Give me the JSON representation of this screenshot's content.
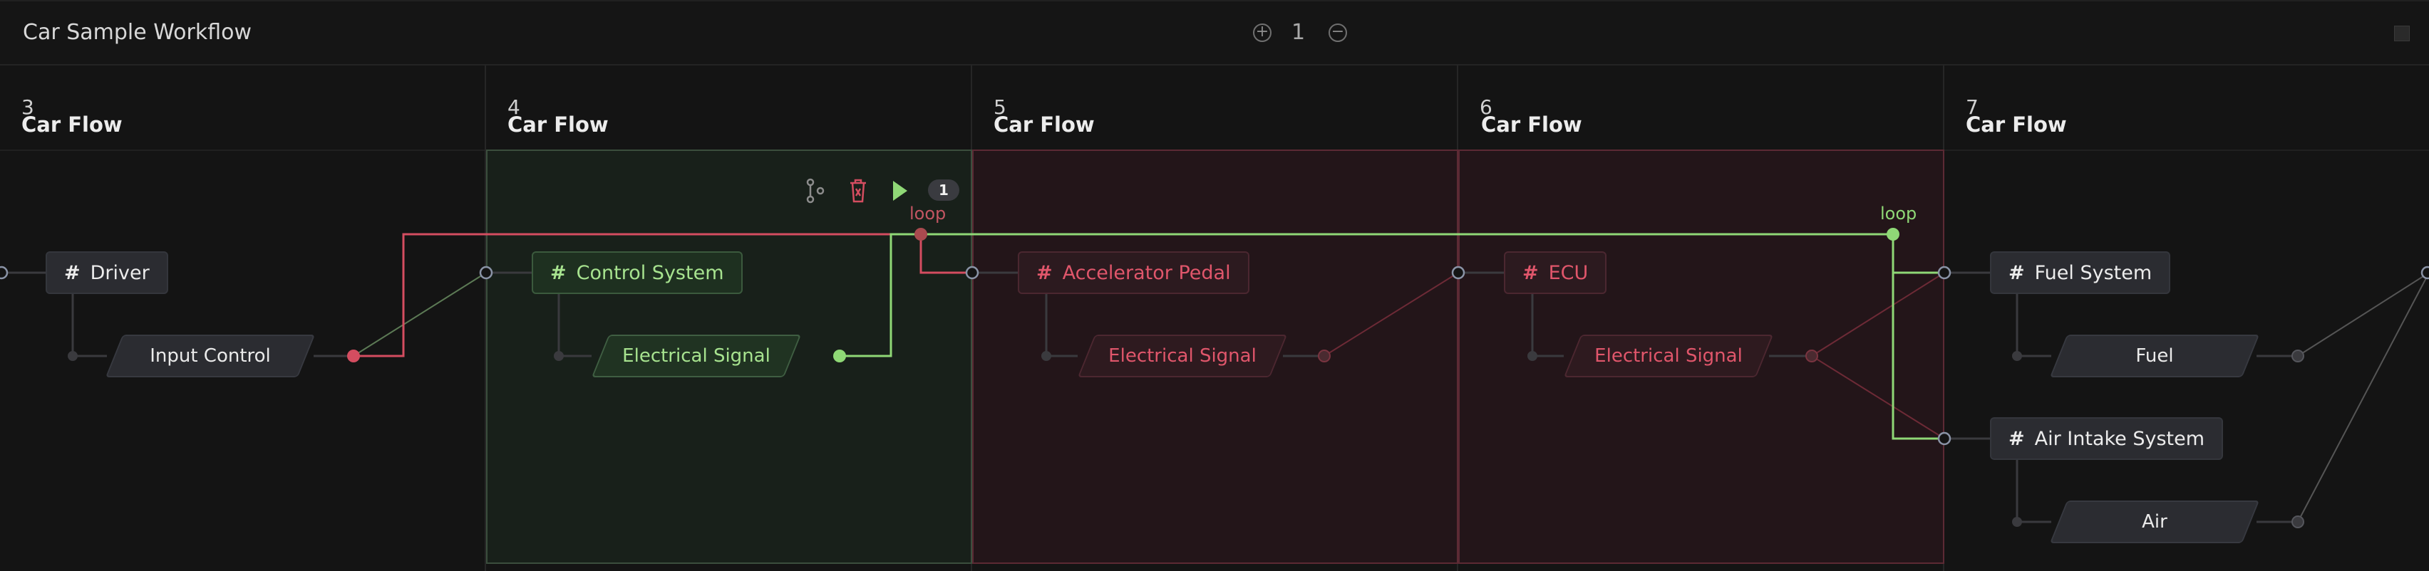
{
  "header": {
    "title": "Car Sample Workflow",
    "zoom_level": "1",
    "zoom_in_icon": "plus-circle-icon",
    "zoom_out_icon": "minus-circle-icon",
    "panel_toggle_icon": "collapse-panel-icon"
  },
  "columns": [
    {
      "number": "3",
      "title": "Car Flow"
    },
    {
      "number": "4",
      "title": "Car Flow"
    },
    {
      "number": "5",
      "title": "Car Flow"
    },
    {
      "number": "6",
      "title": "Car Flow"
    },
    {
      "number": "7",
      "title": "Car Flow"
    }
  ],
  "toolbar": {
    "icons": [
      "branch-icon",
      "delete-icon",
      "play-icon"
    ],
    "run_count": "1"
  },
  "nodes": {
    "driver": "Driver",
    "input_control": "Input Control",
    "control_system": "Control System",
    "signal_4": "Electrical Signal",
    "accelerator_pedal": "Accelerator Pedal",
    "signal_5": "Electrical Signal",
    "ecu": "ECU",
    "signal_6": "Electrical Signal",
    "fuel_system": "Fuel System",
    "fuel": "Fuel",
    "air_intake_system": "Air Intake System",
    "air": "Air"
  },
  "loops": {
    "red": "loop",
    "green": "loop"
  },
  "colors": {
    "background": "#141414",
    "green_accent": "#9be07c",
    "red_accent": "#e0566b",
    "node_gray": "#2b2c31"
  }
}
